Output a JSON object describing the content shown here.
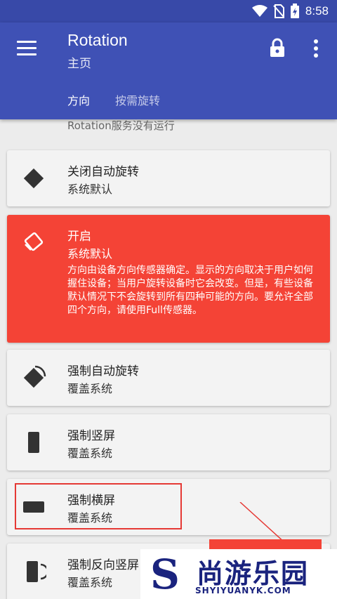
{
  "status_bar": {
    "time": "8:58",
    "icons": [
      "wifi-icon",
      "no-sim-icon",
      "battery-charging-icon"
    ]
  },
  "app_bar": {
    "title": "Rotation",
    "subtitle": "主页",
    "tabs": [
      {
        "label": "方向",
        "active": true
      },
      {
        "label": "按需旋转",
        "active": false
      }
    ],
    "icons": [
      "menu-icon",
      "lock-icon",
      "more-vert-icon"
    ]
  },
  "partial_status": "Rotation服务没有运行",
  "items": [
    {
      "name": "关闭自动旋转",
      "sub": "系统默认",
      "icon": "rotation-lock-icon"
    },
    {
      "name": "开启",
      "sub": "系统默认",
      "icon": "auto-rotate-icon",
      "active": true,
      "desc": "方向由设备方向传感器确定。显示的方向取决于用户如何握住设备；当用户旋转设备时它会改变。但是，有些设备默认情况下不会旋转到所有四种可能的方向。要允许全部四个方向，请使用Full传感器。"
    },
    {
      "name": "强制自动旋转",
      "sub": "覆盖系统",
      "icon": "force-auto-rotate-icon"
    },
    {
      "name": "强制竖屏",
      "sub": "覆盖系统",
      "icon": "portrait-icon"
    },
    {
      "name": "强制横屏",
      "sub": "覆盖系统",
      "icon": "landscape-icon"
    },
    {
      "name": "强制反向竖屏",
      "sub": "覆盖系统",
      "icon": "reverse-portrait-icon"
    }
  ],
  "watermark": {
    "brand": "尚游乐园",
    "domain": "SHYIYUANYK.COM",
    "colors": {
      "brand": "#1a237e"
    }
  },
  "colors": {
    "primary": "#3f51b5",
    "accent": "#f44336"
  }
}
